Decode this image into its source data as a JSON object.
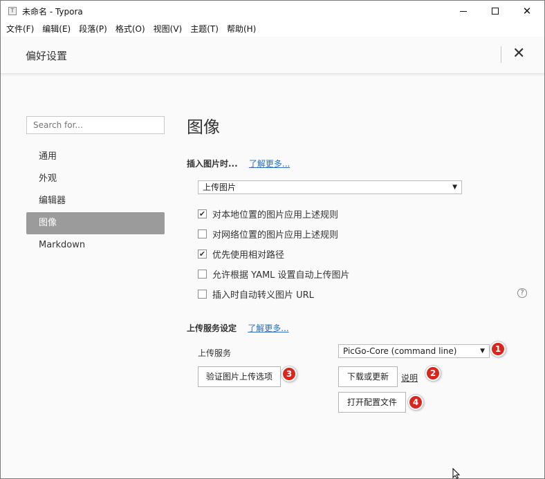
{
  "window": {
    "title": "未命名 - Typora",
    "app_icon_letter": "T"
  },
  "menu": [
    "文件(F)",
    "编辑(E)",
    "段落(P)",
    "格式(O)",
    "视图(V)",
    "主题(T)",
    "帮助(H)"
  ],
  "preferences": {
    "title": "偏好设置",
    "close": "✕"
  },
  "sidebar": {
    "search_placeholder": "Search for...",
    "items": [
      {
        "label": "通用"
      },
      {
        "label": "外观"
      },
      {
        "label": "编辑器"
      },
      {
        "label": "图像",
        "active": true
      },
      {
        "label": "Markdown"
      }
    ]
  },
  "main": {
    "section_title": "图像",
    "insert_heading": "插入图片时...",
    "insert_learn_more": "了解更多...",
    "insert_select_value": "上传图片",
    "checkboxes": [
      {
        "label": "对本地位置的图片应用上述规则",
        "checked": true
      },
      {
        "label": "对网络位置的图片应用上述规则",
        "checked": false
      },
      {
        "label": "优先使用相对路径",
        "checked": true
      },
      {
        "label": "允许根据 YAML 设置自动上传图片",
        "checked": false
      },
      {
        "label": "插入时自动转义图片 URL",
        "checked": false
      }
    ],
    "help_icon": "?",
    "upload_heading": "上传服务设定",
    "upload_learn_more": "了解更多...",
    "upload_service_label": "上传服务",
    "upload_service_value": "PicGo-Core (command line)",
    "verify_button": "验证图片上传选项",
    "download_button": "下载或更新",
    "explain_link": "说明",
    "open_config_button": "打开配置文件",
    "badges": [
      "1",
      "2",
      "3",
      "4"
    ]
  },
  "colors": {
    "badge": "#d9251c",
    "link": "#2a6fbf",
    "active_nav": "#9b9b9b"
  }
}
